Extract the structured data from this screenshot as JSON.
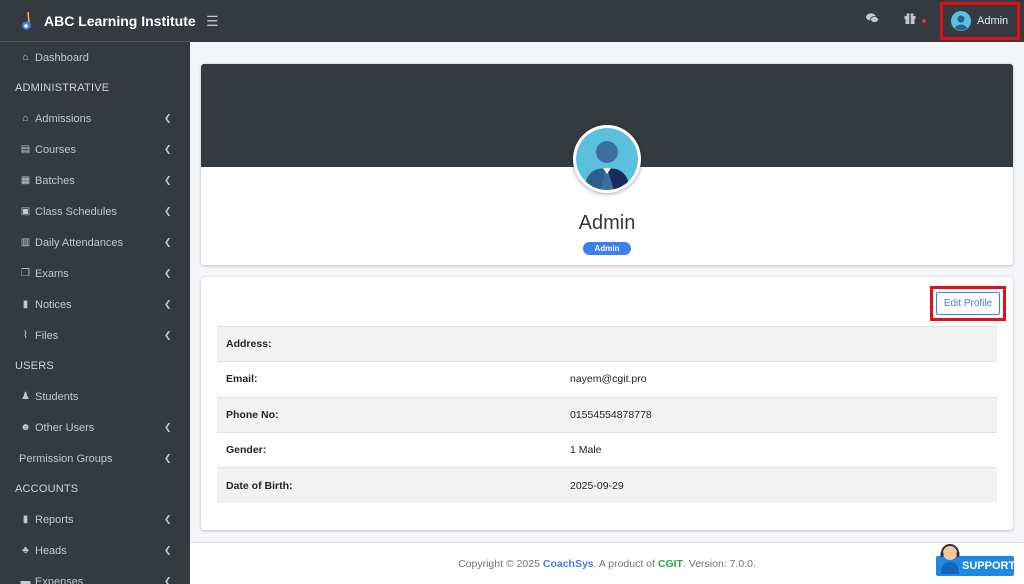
{
  "brand": {
    "title": "ABC Learning Institute"
  },
  "topbar": {
    "menu_icon": "hamburger-icon",
    "icons": [
      "comments-icon",
      "gift-icon"
    ],
    "user_name": "Admin"
  },
  "sidebar": {
    "items": [
      {
        "type": "item",
        "label": "Dashboard",
        "icon": "home-icon",
        "glyph": "⌂",
        "chevron": false
      },
      {
        "type": "header",
        "label": "ADMINISTRATIVE"
      },
      {
        "type": "item",
        "label": "Admissions",
        "icon": "house-user-icon",
        "glyph": "⌂",
        "chevron": true
      },
      {
        "type": "item",
        "label": "Courses",
        "icon": "book-icon",
        "glyph": "▤",
        "chevron": true
      },
      {
        "type": "item",
        "label": "Batches",
        "icon": "grid-icon",
        "glyph": "▦",
        "chevron": true
      },
      {
        "type": "item",
        "label": "Class Schedules",
        "icon": "calendar-check-icon",
        "glyph": "▣",
        "chevron": true
      },
      {
        "type": "item",
        "label": "Daily Attendances",
        "icon": "clipboard-icon",
        "glyph": "▥",
        "chevron": true
      },
      {
        "type": "item",
        "label": "Exams",
        "icon": "copy-icon",
        "glyph": "❐",
        "chevron": true
      },
      {
        "type": "item",
        "label": "Notices",
        "icon": "sticky-note-icon",
        "glyph": "▮",
        "chevron": true
      },
      {
        "type": "item",
        "label": "Files",
        "icon": "paperclip-icon",
        "glyph": "⌇",
        "chevron": true
      },
      {
        "type": "header",
        "label": "USERS"
      },
      {
        "type": "item",
        "label": "Students",
        "icon": "user-graduate-icon",
        "glyph": "♟",
        "chevron": false
      },
      {
        "type": "item",
        "label": "Other Users",
        "icon": "users-icon",
        "glyph": "☻",
        "chevron": true
      },
      {
        "type": "item",
        "label": "Permission Groups",
        "icon": "",
        "glyph": "",
        "chevron": true
      },
      {
        "type": "header",
        "label": "ACCOUNTS"
      },
      {
        "type": "item",
        "label": "Reports",
        "icon": "file-icon",
        "glyph": "▮",
        "chevron": true
      },
      {
        "type": "item",
        "label": "Heads",
        "icon": "sitemap-icon",
        "glyph": "♣",
        "chevron": true
      },
      {
        "type": "item",
        "label": "Expenses",
        "icon": "money-icon",
        "glyph": "▬",
        "chevron": true
      }
    ]
  },
  "profile": {
    "name": "Admin",
    "role_badge": "Admin",
    "edit_label": "Edit Profile",
    "details": [
      {
        "label": "Address:",
        "value": ""
      },
      {
        "label": "Email:",
        "value": "nayem@cgit.pro"
      },
      {
        "label": "Phone No:",
        "value": "01554554878778"
      },
      {
        "label": "Gender:",
        "value": "1 Male"
      },
      {
        "label": "Date of Birth:",
        "value": "2025-09-29"
      }
    ]
  },
  "footer": {
    "prefix": "Copyright © 2025 ",
    "product": "CoachSys",
    "middle": ". A product of ",
    "company": "CGIT",
    "suffix": ". Version: 7.0.0."
  },
  "support": {
    "label": "SUPPORT"
  },
  "colors": {
    "sidebar": "#343a40",
    "primary": "#3f7ef0",
    "highlight": "#e0101a"
  }
}
